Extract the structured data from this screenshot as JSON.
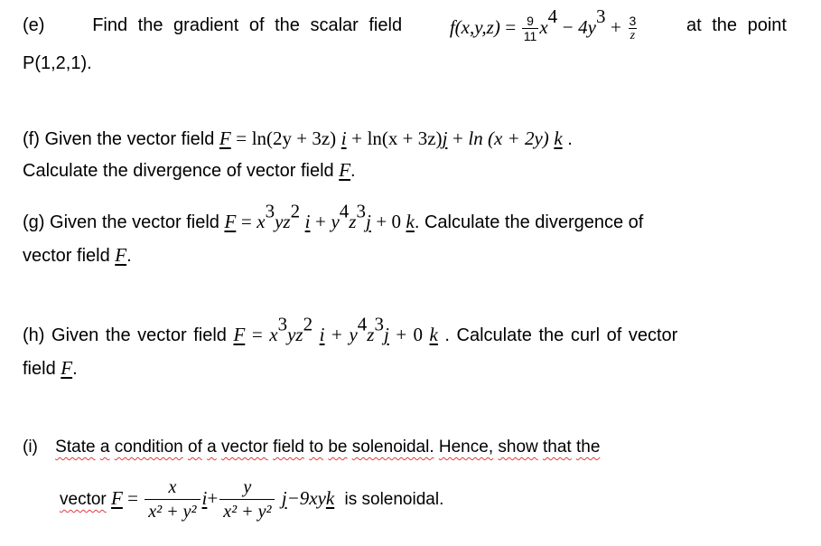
{
  "questions": {
    "e": {
      "label": "(e)",
      "text1": "Find the gradient of the scalar field",
      "func": "f(x,y,z)",
      "eq": "=",
      "frac1_num": "9",
      "frac1_den": "11",
      "term1": "x",
      "term1_exp": "4",
      "minus": "−",
      "term2": "4y",
      "term2_exp": "3",
      "plus": "+",
      "frac2_num": "3",
      "frac2_den": "z",
      "text2": "at the point",
      "point": "P(1,2,1)."
    },
    "f": {
      "label": "(f)",
      "text1": "Given the vector field",
      "F": "F",
      "eq": "=",
      "comp1": "ln(2y + 3z)",
      "i": "i",
      "plus1": "+",
      "comp2": "ln(x + 3z)",
      "j": "j",
      "plus2": "+",
      "comp3": "ln (x + 2y)",
      "k": "k",
      "end": ".",
      "line2": "Calculate the divergence of vector field",
      "F2": "F",
      "period": "."
    },
    "g": {
      "label": "(g)",
      "text1": "Given the vector field",
      "F": "F",
      "eq": "=",
      "x": "x",
      "x_exp": "3",
      "yz": "yz",
      "z_exp": "2",
      "i": "i",
      "plus1": "+",
      "y": "y",
      "y_exp": "4",
      "z": "z",
      "z2_exp": "3",
      "j": "j",
      "plus2": "+ 0",
      "k": "k",
      "text2": ". Calculate the divergence of",
      "line2": "vector field",
      "F2": "F",
      "period": "."
    },
    "h": {
      "label": "(h)",
      "text1": "Given the vector field",
      "F": "F",
      "eq": "=",
      "x": "x",
      "x_exp": "3",
      "yz": "yz",
      "z_exp": "2",
      "i": "i",
      "plus1": "+",
      "y": "y",
      "y_exp": "4",
      "z": "z",
      "z2_exp": "3",
      "j": "j",
      "plus2": "+ 0",
      "k": "k",
      "text2": ". Calculate the curl of vector",
      "line2": "field",
      "F2": "F",
      "period": "."
    },
    "i": {
      "label": "(i)",
      "words": [
        "State",
        "a",
        "condition",
        "of",
        "a",
        "vector",
        "field",
        "to",
        "be",
        "solenoidal.",
        "Hence,",
        "show",
        "that",
        "the"
      ],
      "line2_word": "vector",
      "F": "F",
      "eq": "=",
      "frac1_num": "x",
      "frac1_den": "x² + y²",
      "i": "i",
      "plus": "+",
      "frac2_num": "y",
      "frac2_den": "x² + y²",
      "j": "j",
      "minus_term": "−9xy",
      "k": "k",
      "end_text": "is solenoidal."
    }
  }
}
